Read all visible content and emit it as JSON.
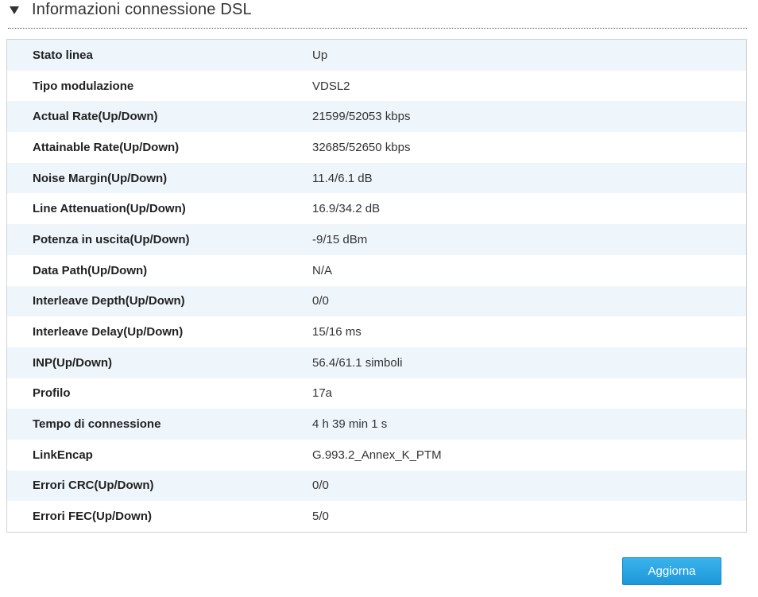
{
  "section": {
    "title": "Informazioni connessione DSL",
    "toggle_icon": "triangle-down-icon"
  },
  "rows": [
    {
      "label": "Stato linea",
      "value": "Up"
    },
    {
      "label": "Tipo modulazione",
      "value": "VDSL2"
    },
    {
      "label": "Actual Rate(Up/Down)",
      "value": "21599/52053 kbps"
    },
    {
      "label": "Attainable Rate(Up/Down)",
      "value": "32685/52650 kbps"
    },
    {
      "label": "Noise Margin(Up/Down)",
      "value": "11.4/6.1 dB"
    },
    {
      "label": "Line Attenuation(Up/Down)",
      "value": "16.9/34.2 dB"
    },
    {
      "label": "Potenza in uscita(Up/Down)",
      "value": "-9/15 dBm"
    },
    {
      "label": "Data Path(Up/Down)",
      "value": "N/A"
    },
    {
      "label": "Interleave Depth(Up/Down)",
      "value": "0/0"
    },
    {
      "label": "Interleave Delay(Up/Down)",
      "value": "15/16 ms"
    },
    {
      "label": "INP(Up/Down)",
      "value": "56.4/61.1 simboli"
    },
    {
      "label": "Profilo",
      "value": "17a"
    },
    {
      "label": "Tempo di connessione",
      "value": "4 h 39 min 1 s"
    },
    {
      "label": "LinkEncap",
      "value": "G.993.2_Annex_K_PTM"
    },
    {
      "label": "Errori CRC(Up/Down)",
      "value": "0/0"
    },
    {
      "label": "Errori FEC(Up/Down)",
      "value": "5/0"
    }
  ],
  "actions": {
    "refresh_label": "Aggiorna"
  },
  "colors": {
    "accent": "#2aa5e2",
    "row_alt": "#eef5fb",
    "border": "#d3d3d3"
  }
}
